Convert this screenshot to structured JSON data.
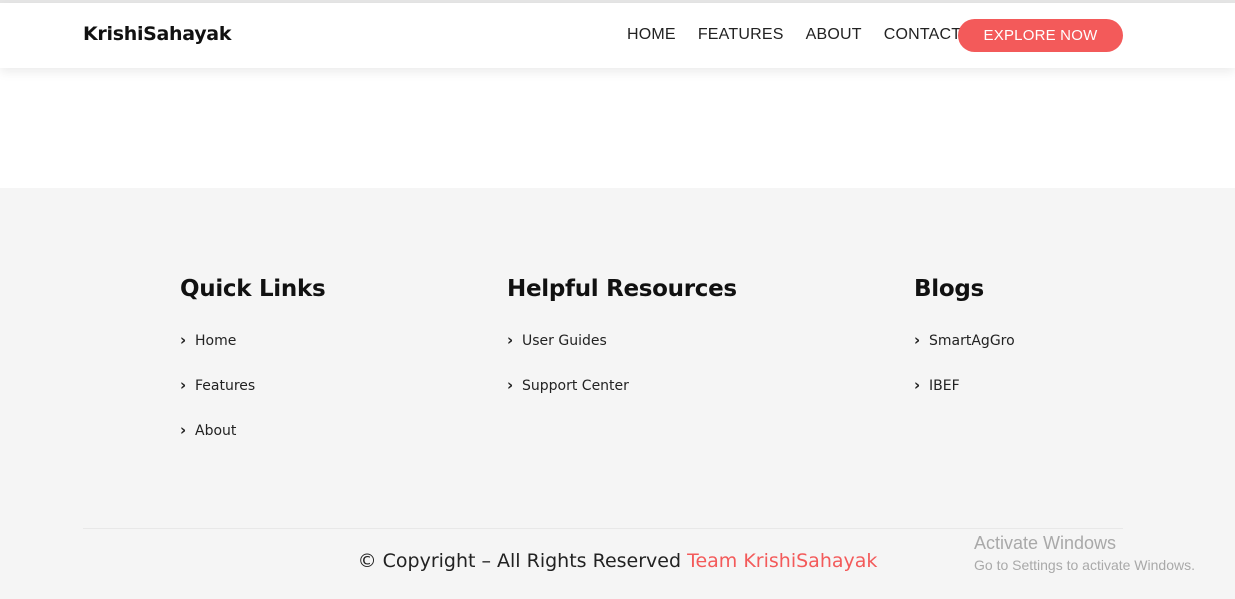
{
  "brand": "KrishiSahayak",
  "nav": {
    "items": [
      "HOME",
      "FEATURES",
      "ABOUT",
      "CONTACT"
    ],
    "cta": "EXPLORE NOW"
  },
  "footer": {
    "columns": [
      {
        "title": "Quick Links",
        "links": [
          "Home",
          "Features",
          "About"
        ]
      },
      {
        "title": "Helpful Resources",
        "links": [
          "User Guides",
          "Support Center"
        ]
      },
      {
        "title": "Blogs",
        "links": [
          "SmartAgGro",
          "IBEF"
        ]
      }
    ],
    "copyright_prefix": "© Copyright – All Rights Reserved",
    "copyright_team": "Team KrishiSahayak"
  },
  "overlay": {
    "activate_title": "Activate Windows",
    "activate_subtitle": "Go to Settings to activate Windows."
  },
  "icons": {
    "link_bullet": "chevron-right-icon"
  },
  "colors": {
    "accent": "#f35a5a",
    "footer_bg": "#f5f5f5"
  }
}
